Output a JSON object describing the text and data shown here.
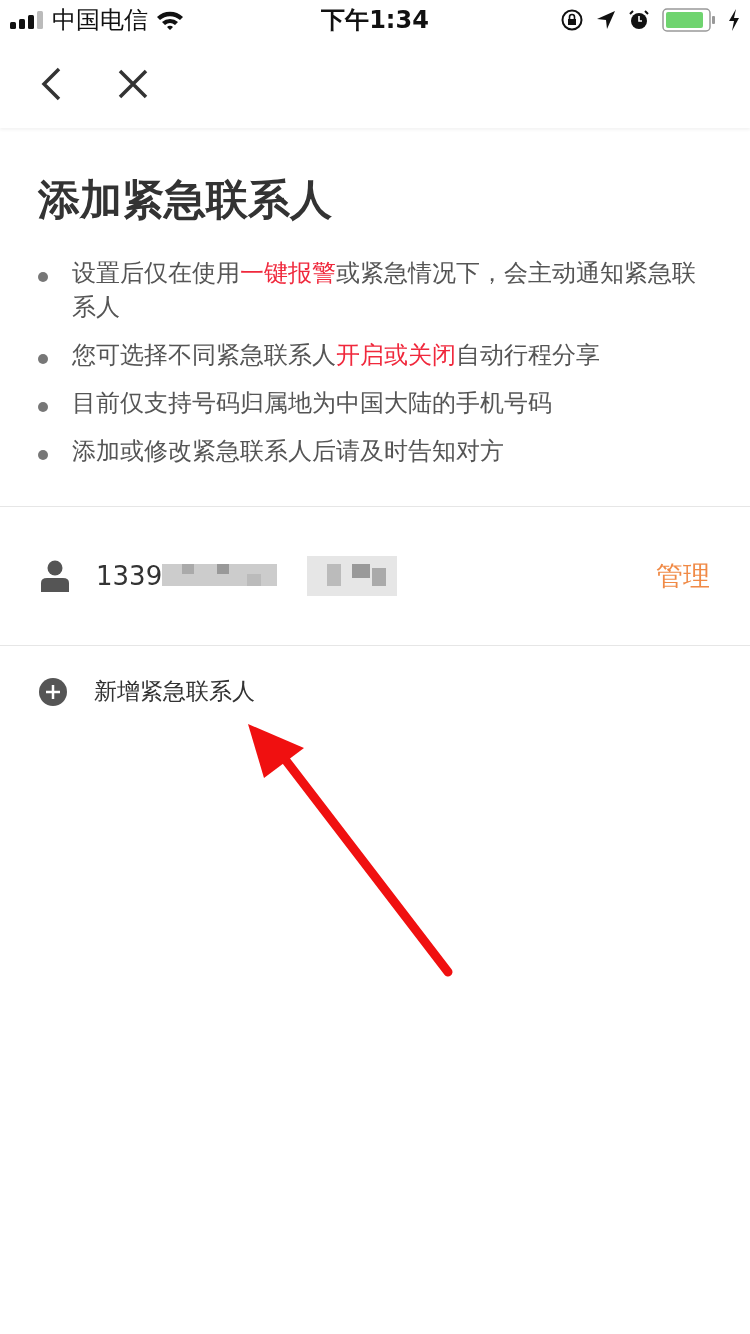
{
  "status_bar": {
    "carrier": "中国电信",
    "time": "下午1:34"
  },
  "title": "添加紧急联系人",
  "notes": [
    {
      "parts": [
        {
          "text": "设置后仅在使用",
          "highlight": false
        },
        {
          "text": "一键报警",
          "highlight": true
        },
        {
          "text": "或紧急情况下，会主动通知紧急联系人",
          "highlight": false
        }
      ]
    },
    {
      "parts": [
        {
          "text": "您可选择不同紧急联系人",
          "highlight": false
        },
        {
          "text": "开启或关闭",
          "highlight": true
        },
        {
          "text": "自动行程分享",
          "highlight": false
        }
      ]
    },
    {
      "parts": [
        {
          "text": "目前仅支持号码归属地为中国大陆的手机号码",
          "highlight": false
        }
      ]
    },
    {
      "parts": [
        {
          "text": "添加或修改紧急联系人后请及时告知对方",
          "highlight": false
        }
      ]
    }
  ],
  "contacts": [
    {
      "phone": "1339",
      "redacted": true,
      "action": "管理"
    }
  ],
  "add_button": "新增紧急联系人",
  "annotation": {
    "kind": "arrow"
  }
}
